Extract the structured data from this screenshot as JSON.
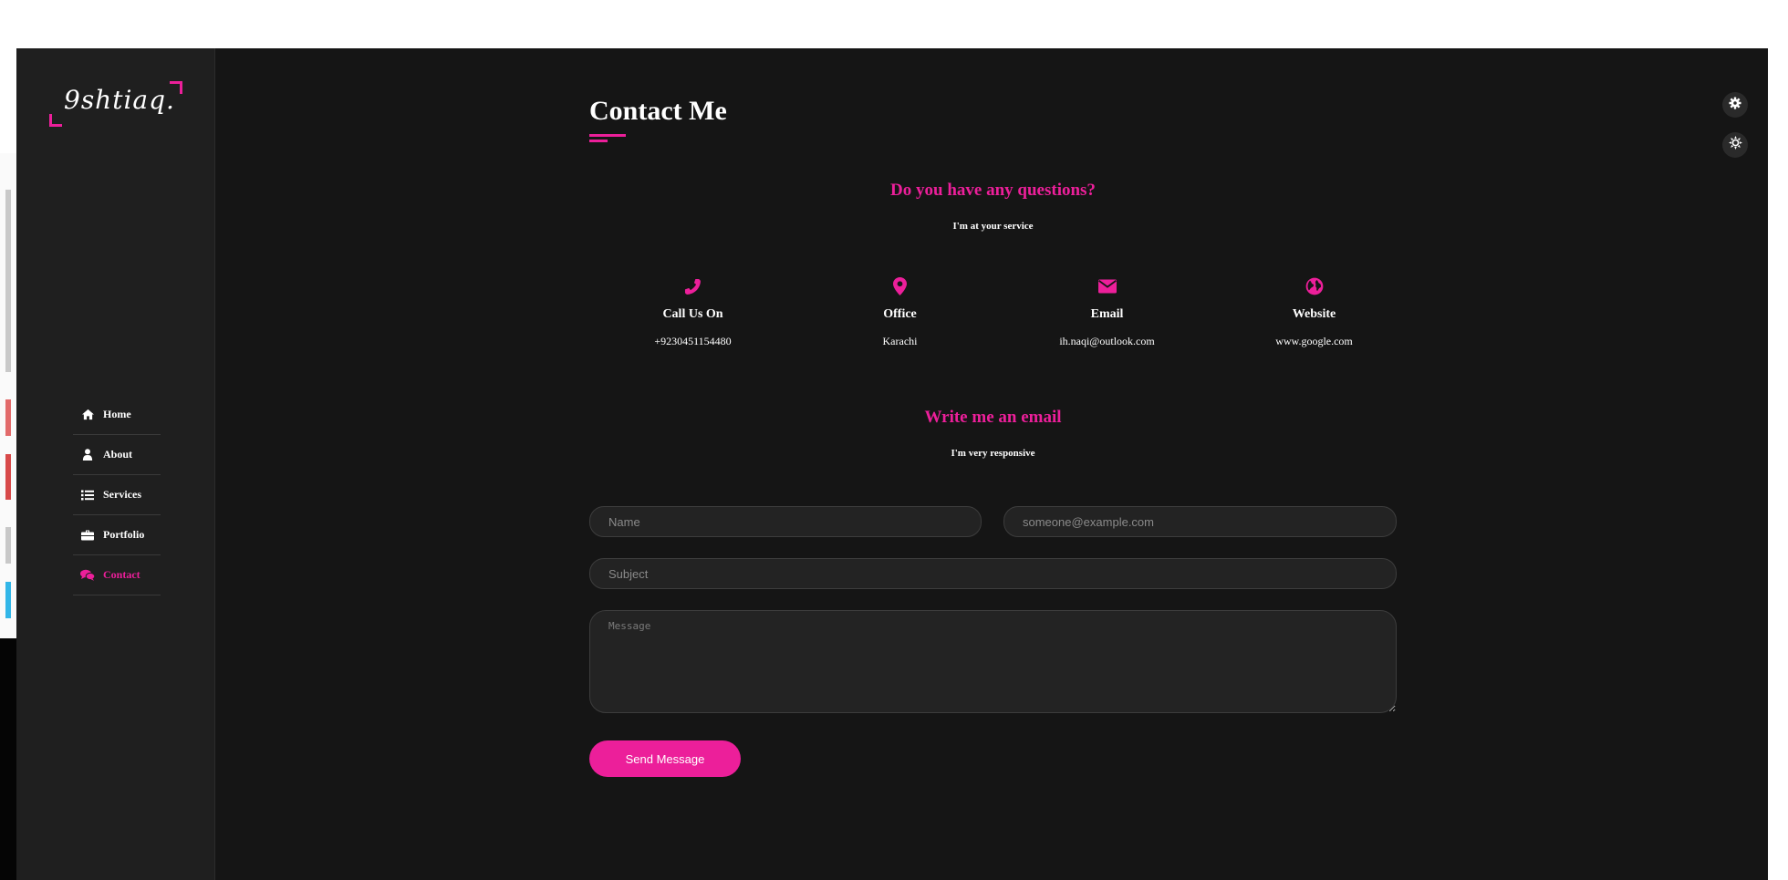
{
  "logo": {
    "text": "9shtiaq."
  },
  "nav": {
    "items": [
      {
        "label": "Home",
        "icon": "home-icon",
        "active": false
      },
      {
        "label": "About",
        "icon": "user-icon",
        "active": false
      },
      {
        "label": "Services",
        "icon": "list-icon",
        "active": false
      },
      {
        "label": "Portfolio",
        "icon": "briefcase-icon",
        "active": false
      },
      {
        "label": "Contact",
        "icon": "chat-icon",
        "active": true
      }
    ]
  },
  "toggles": {
    "settings_icon": "gear-icon",
    "theme_icon": "sun-icon"
  },
  "page": {
    "title": "Contact Me"
  },
  "questions": {
    "heading": "Do you have any questions?",
    "subheading": "I'm at your service"
  },
  "contact_info": [
    {
      "icon": "phone-icon",
      "title": "Call Us On",
      "value": "+9230451154480"
    },
    {
      "icon": "map-pin-icon",
      "title": "Office",
      "value": "Karachi"
    },
    {
      "icon": "envelope-icon",
      "title": "Email",
      "value": "ih.naqi@outlook.com"
    },
    {
      "icon": "globe-icon",
      "title": "Website",
      "value": "www.google.com"
    }
  ],
  "email_section": {
    "heading": "Write me an email",
    "subheading": "I'm very responsive"
  },
  "form": {
    "name_placeholder": "Name",
    "email_placeholder": "someone@example.com",
    "subject_placeholder": "Subject",
    "message_placeholder": "Message",
    "submit_label": "Send Message"
  },
  "colors": {
    "accent": "#ec1f9a",
    "background": "#151515",
    "sidebar": "#1f1f1f",
    "field": "#232323"
  }
}
